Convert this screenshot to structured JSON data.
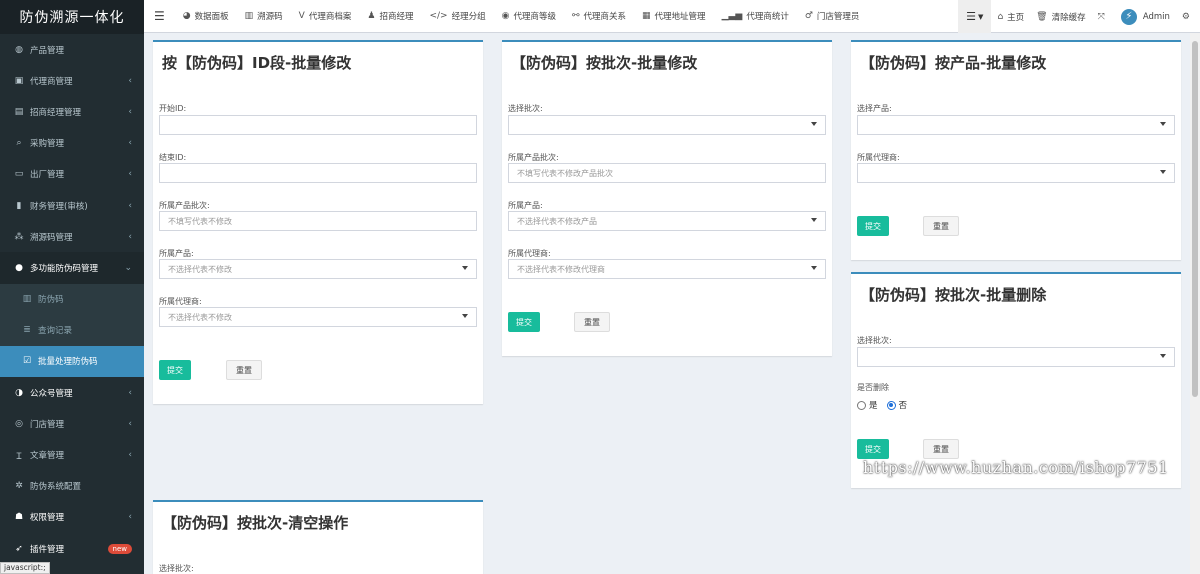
{
  "app": {
    "title": "防伪溯源一体化"
  },
  "sidebar": {
    "items": [
      {
        "label": "产品管理",
        "icon": "globe-icon",
        "caret": ""
      },
      {
        "label": "代理商管理",
        "icon": "id-card-icon",
        "caret": "‹"
      },
      {
        "label": "招商经理管理",
        "icon": "address-book-icon",
        "caret": "‹"
      },
      {
        "label": "采购管理",
        "icon": "search-icon",
        "caret": "‹"
      },
      {
        "label": "出厂管理",
        "icon": "truck-icon",
        "caret": "‹"
      },
      {
        "label": "财务管理(审核)",
        "icon": "book-icon",
        "caret": "‹"
      },
      {
        "label": "溯源码管理",
        "icon": "cubes-icon",
        "caret": "‹"
      },
      {
        "label": "多功能防伪码管理",
        "icon": "info-circle-icon",
        "caret": "⌄"
      }
    ],
    "subitems": [
      {
        "label": "防伪码",
        "icon": "barcode-icon"
      },
      {
        "label": "查询记录",
        "icon": "list-icon"
      },
      {
        "label": "批量处理防伪码",
        "icon": "edit-icon"
      }
    ],
    "bottom_items": [
      {
        "label": "公众号管理",
        "icon": "wechat-icon",
        "caret": "‹"
      },
      {
        "label": "门店管理",
        "icon": "store-icon",
        "caret": "‹"
      },
      {
        "label": "文章管理",
        "icon": "text-icon",
        "caret": "‹"
      },
      {
        "label": "防伪系统配置",
        "icon": "cog-icon",
        "caret": ""
      },
      {
        "label": "权限管理",
        "icon": "group-icon",
        "caret": "‹"
      },
      {
        "label": "插件管理",
        "icon": "rocket-icon",
        "badge": "new"
      }
    ],
    "status_text": "javascript:;"
  },
  "topnav": {
    "items": [
      {
        "label": "数据面板",
        "icon": "dashboard-icon"
      },
      {
        "label": "溯源码",
        "icon": "barcode-icon"
      },
      {
        "label": "代理商档案",
        "icon": "vine-icon"
      },
      {
        "label": "招商经理",
        "icon": "user-tie-icon"
      },
      {
        "label": "经理分组",
        "icon": "code-icon"
      },
      {
        "label": "代理商等级",
        "icon": "dot-circle-icon"
      },
      {
        "label": "代理商关系",
        "icon": "sitemap-icon"
      },
      {
        "label": "代理地址管理",
        "icon": "building-icon"
      },
      {
        "label": "代理商统计",
        "icon": "bar-chart-icon"
      },
      {
        "label": "门店管理员",
        "icon": "male-icon"
      }
    ],
    "right": {
      "home": "主页",
      "clear_cache": "清除缓存",
      "user": "Admin"
    }
  },
  "forms": {
    "by_id": {
      "title": "按【防伪码】ID段-批量修改",
      "start_label": "开始ID:",
      "end_label": "结束ID:",
      "batch_label": "所属产品批次:",
      "batch_placeholder": "不填写代表不修改",
      "product_label": "所属产品:",
      "product_placeholder": "不选择代表不修改",
      "agent_label": "所属代理商:",
      "agent_placeholder": "不选择代表不修改",
      "submit": "提交",
      "reset": "重置"
    },
    "by_batch": {
      "title": "【防伪码】按批次-批量修改",
      "select_batch_label": "选择批次:",
      "batch_label": "所属产品批次:",
      "batch_placeholder": "不填写代表不修改产品批次",
      "product_label": "所属产品:",
      "product_placeholder": "不选择代表不修改产品",
      "agent_label": "所属代理商:",
      "agent_placeholder": "不选择代表不修改代理商",
      "submit": "提交",
      "reset": "重置"
    },
    "by_product": {
      "title": "【防伪码】按产品-批量修改",
      "product_label": "选择产品:",
      "agent_label": "所属代理商:",
      "submit": "提交",
      "reset": "重置"
    },
    "delete_batch": {
      "title": "【防伪码】按批次-批量删除",
      "select_batch_label": "选择批次:",
      "confirm_label": "是否删除",
      "yes": "是",
      "no": "否",
      "submit": "提交",
      "reset": "重置"
    },
    "clear_batch": {
      "title": "【防伪码】按批次-清空操作",
      "select_batch_label": "选择批次:"
    }
  },
  "watermark": "https://www.huzhan.com/ishop7751"
}
